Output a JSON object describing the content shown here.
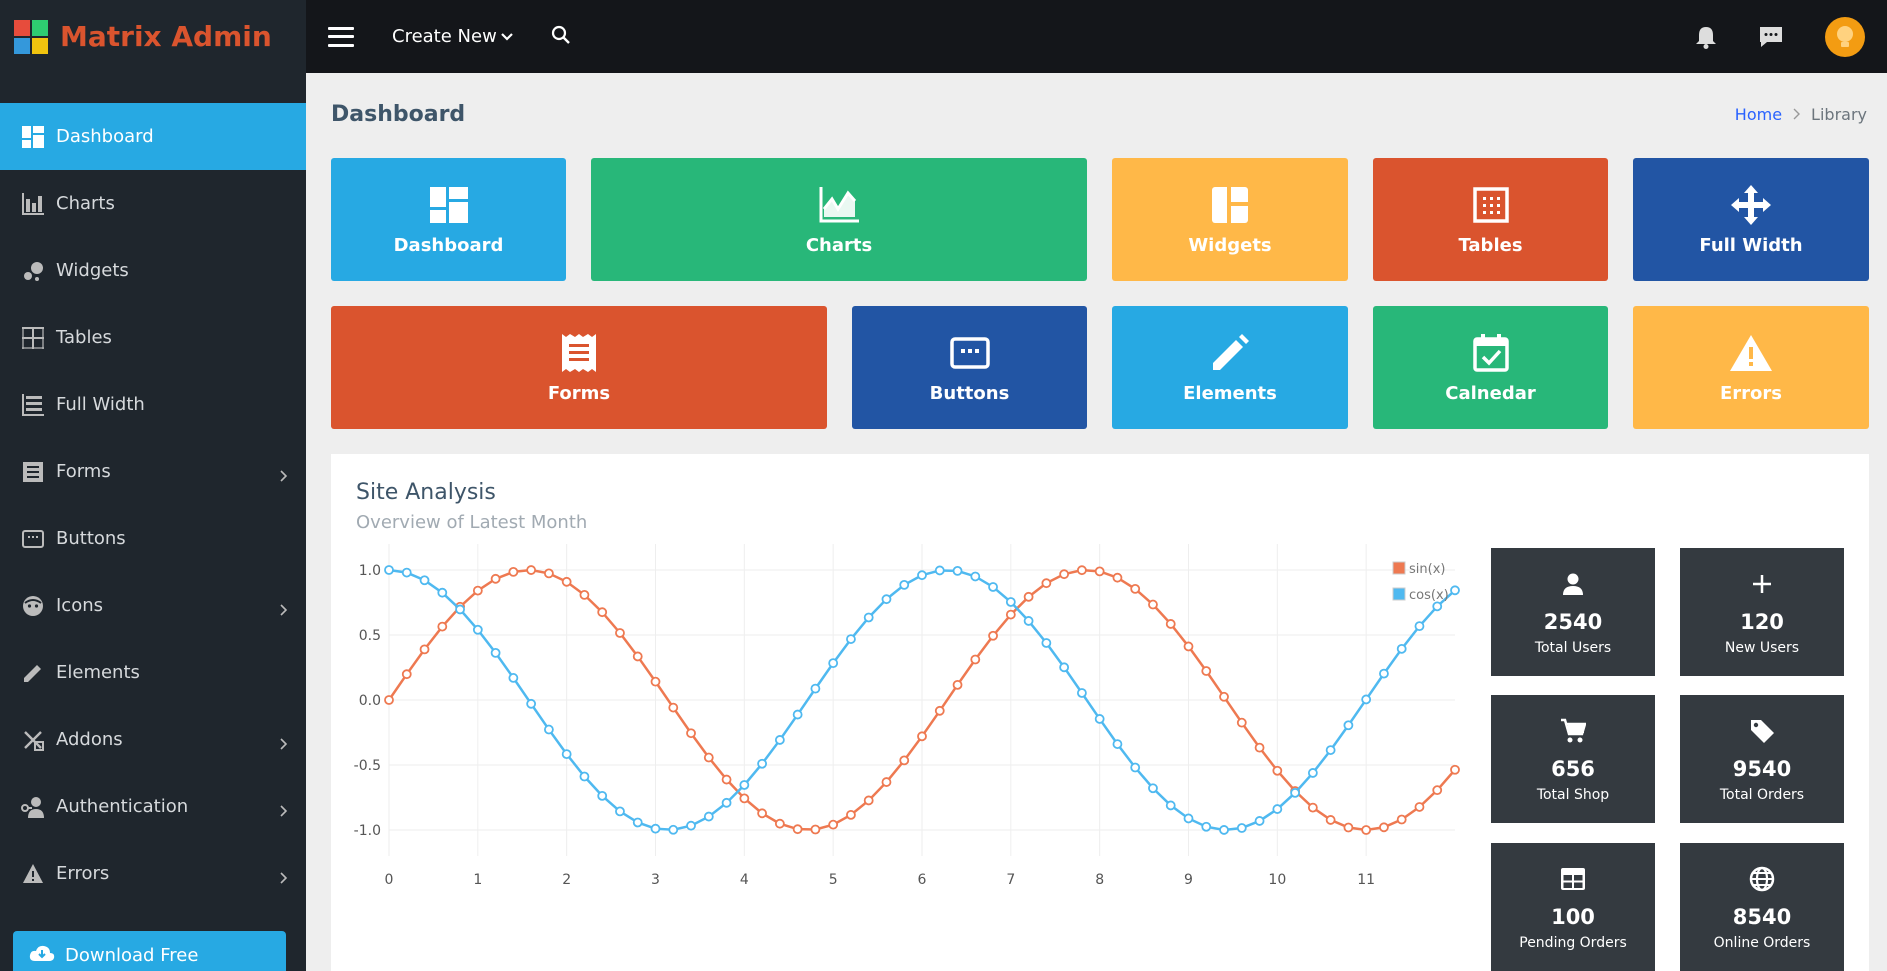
{
  "brand": {
    "name": "Matrix Admin",
    "logo_colors": [
      "#e74c3c",
      "#2ecc71",
      "#3498db",
      "#f1c40f"
    ]
  },
  "topbar": {
    "create_new": "Create New"
  },
  "sidebar": {
    "items": [
      {
        "label": "Dashboard",
        "icon": "dashboard-icon",
        "active": true
      },
      {
        "label": "Charts",
        "icon": "bar-chart-icon"
      },
      {
        "label": "Widgets",
        "icon": "bubbles-icon"
      },
      {
        "label": "Tables",
        "icon": "table-border-icon"
      },
      {
        "label": "Full Width",
        "icon": "view-list-icon"
      },
      {
        "label": "Forms",
        "icon": "receipt-icon",
        "has_children": true
      },
      {
        "label": "Buttons",
        "icon": "keyboard-icon"
      },
      {
        "label": "Icons",
        "icon": "face-icon",
        "has_children": true
      },
      {
        "label": "Elements",
        "icon": "pencil-icon"
      },
      {
        "label": "Addons",
        "icon": "multiplication-icon",
        "has_children": true
      },
      {
        "label": "Authentication",
        "icon": "account-key-icon",
        "has_children": true
      },
      {
        "label": "Errors",
        "icon": "alert-icon",
        "has_children": true
      }
    ],
    "download": "Download Free"
  },
  "page": {
    "title": "Dashboard",
    "breadcrumb": {
      "home": "Home",
      "current": "Library"
    }
  },
  "tiles": [
    {
      "label": "Dashboard",
      "color": "#27a9e3",
      "icon": "dashboard-icon"
    },
    {
      "label": "Charts",
      "color": "#28b779",
      "icon": "chart-areaspline-icon"
    },
    {
      "label": "Widgets",
      "color": "#ffb848",
      "icon": "collage-icon"
    },
    {
      "label": "Tables",
      "color": "#da542e",
      "icon": "border-outside-icon"
    },
    {
      "label": "Full Width",
      "color": "#2255a4",
      "icon": "arrow-all-icon"
    },
    {
      "label": "Forms",
      "color": "#da542e",
      "icon": "receipt-icon"
    },
    {
      "label": "Buttons",
      "color": "#2255a4",
      "icon": "keyboard-icon"
    },
    {
      "label": "Elements",
      "color": "#27a9e3",
      "icon": "pencil-icon"
    },
    {
      "label": "Calnedar",
      "color": "#28b779",
      "icon": "calendar-check-icon"
    },
    {
      "label": "Errors",
      "color": "#ffb848",
      "icon": "alert-icon"
    }
  ],
  "card": {
    "title": "Site Analysis",
    "subtitle": "Overview of Latest Month"
  },
  "stats": [
    {
      "value": "2540",
      "label": "Total Users",
      "icon": "user-icon"
    },
    {
      "value": "120",
      "label": "New Users",
      "icon": "plus-icon"
    },
    {
      "value": "656",
      "label": "Total Shop",
      "icon": "cart-icon"
    },
    {
      "value": "9540",
      "label": "Total Orders",
      "icon": "tag-icon"
    },
    {
      "value": "100",
      "label": "Pending Orders",
      "icon": "table-icon"
    },
    {
      "value": "8540",
      "label": "Online Orders",
      "icon": "globe-icon"
    }
  ],
  "chart_data": {
    "type": "line",
    "title": "",
    "xlabel": "",
    "ylabel": "",
    "xlim": [
      0,
      12
    ],
    "ylim": [
      -1.2,
      1.2
    ],
    "x_ticks": [
      "0",
      "1",
      "2",
      "3",
      "4",
      "5",
      "6",
      "7",
      "8",
      "9",
      "10",
      "11"
    ],
    "y_ticks": [
      "1.0",
      "0.5",
      "0.0",
      "-0.5",
      "-1.0"
    ],
    "x_tick_values": [
      0,
      1,
      2,
      3,
      4,
      5,
      6,
      7,
      8,
      9,
      10,
      11
    ],
    "y_tick_values": [
      1.0,
      0.5,
      0.0,
      -0.5,
      -1.0
    ],
    "grid": true,
    "legend": "top-right",
    "x_step": 0.2,
    "x_count": 61,
    "series": [
      {
        "name": "sin(x)",
        "color": "#ee7951",
        "function": "sin"
      },
      {
        "name": "cos(x)",
        "color": "#4fb9f0",
        "function": "cos"
      }
    ]
  }
}
